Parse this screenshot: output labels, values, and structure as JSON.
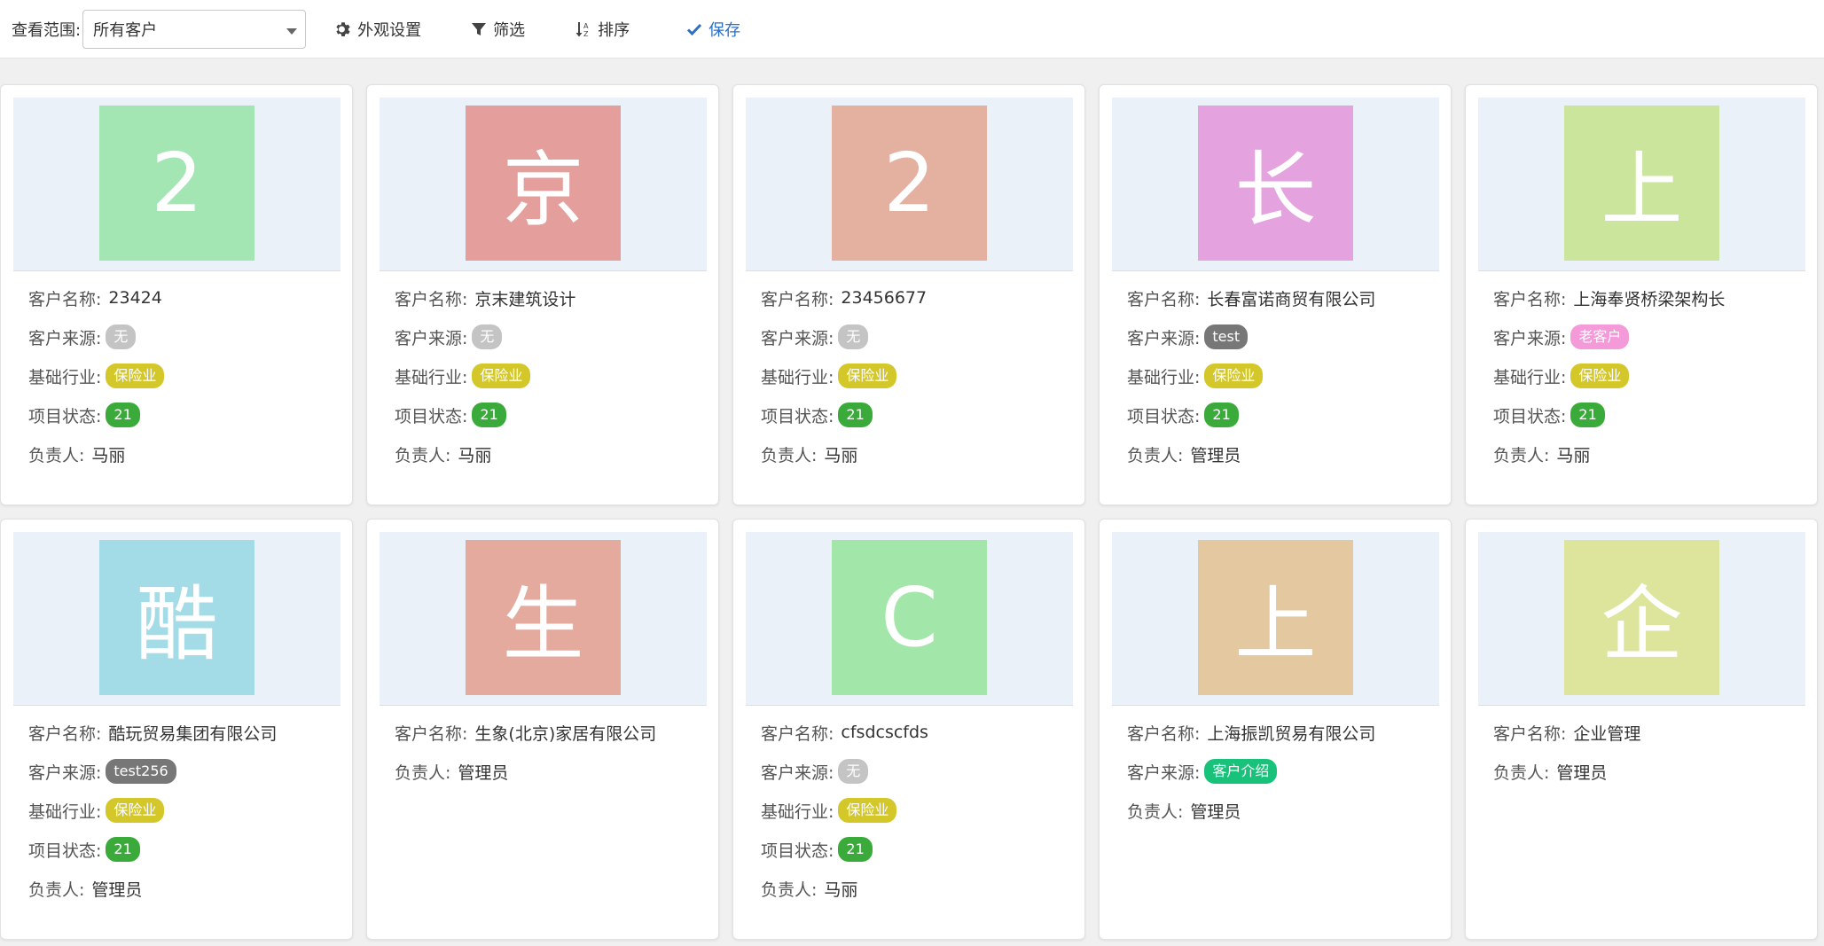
{
  "toolbar": {
    "scope_label": "查看范围:",
    "scope_value": "所有客户",
    "appearance_label": "外观设置",
    "filter_label": "筛选",
    "sort_label": "排序",
    "save_label": "保存",
    "save_color": "#2e6fc4"
  },
  "labels": {
    "name": "客户名称:",
    "source": "客户来源:",
    "industry": "基础行业:",
    "status": "项目状态:",
    "owner": "负责人:"
  },
  "badge_colors": {
    "无": "#c4c4c4",
    "test": "#777777",
    "test256": "#777777",
    "老客户": "#f49ad8",
    "客户介绍": "#19c27a",
    "保险业": "#d4c72a",
    "21": "#3aab3a"
  },
  "cards": [
    {
      "avatar": "2",
      "avatar_color": "#a3e6b4",
      "name": "23424",
      "source": "无",
      "industry": "保险业",
      "status": "21",
      "owner": "马丽"
    },
    {
      "avatar": "京",
      "avatar_color": "#e49e9b",
      "name": "京末建筑设计",
      "source": "无",
      "industry": "保险业",
      "status": "21",
      "owner": "马丽"
    },
    {
      "avatar": "2",
      "avatar_color": "#e4b09f",
      "name": "23456677",
      "source": "无",
      "industry": "保险业",
      "status": "21",
      "owner": "马丽"
    },
    {
      "avatar": "长",
      "avatar_color": "#e4a3df",
      "name": "长春富诺商贸有限公司",
      "source": "test",
      "industry": "保险业",
      "status": "21",
      "owner": "管理员"
    },
    {
      "avatar": "上",
      "avatar_color": "#cbe59d",
      "name": "上海奉贤桥梁架构长",
      "source": "老客户",
      "industry": "保险业",
      "status": "21",
      "owner": "马丽"
    },
    {
      "avatar": "酷",
      "avatar_color": "#a3dce6",
      "name": "酷玩贸易集团有限公司",
      "source": "test256",
      "industry": "保险业",
      "status": "21",
      "owner": "管理员"
    },
    {
      "avatar": "生",
      "avatar_color": "#e4aa9e",
      "name": "生象(北京)家居有限公司",
      "owner": "管理员"
    },
    {
      "avatar": "C",
      "avatar_color": "#a3e6a9",
      "name": "cfsdcscfds",
      "source": "无",
      "industry": "保险业",
      "status": "21",
      "owner": "马丽"
    },
    {
      "avatar": "上",
      "avatar_color": "#e4c89f",
      "name": "上海振凯贸易有限公司",
      "source": "客户介绍",
      "owner": "管理员"
    },
    {
      "avatar": "企",
      "avatar_color": "#dde59d",
      "name": "企业管理",
      "owner": "管理员"
    }
  ]
}
